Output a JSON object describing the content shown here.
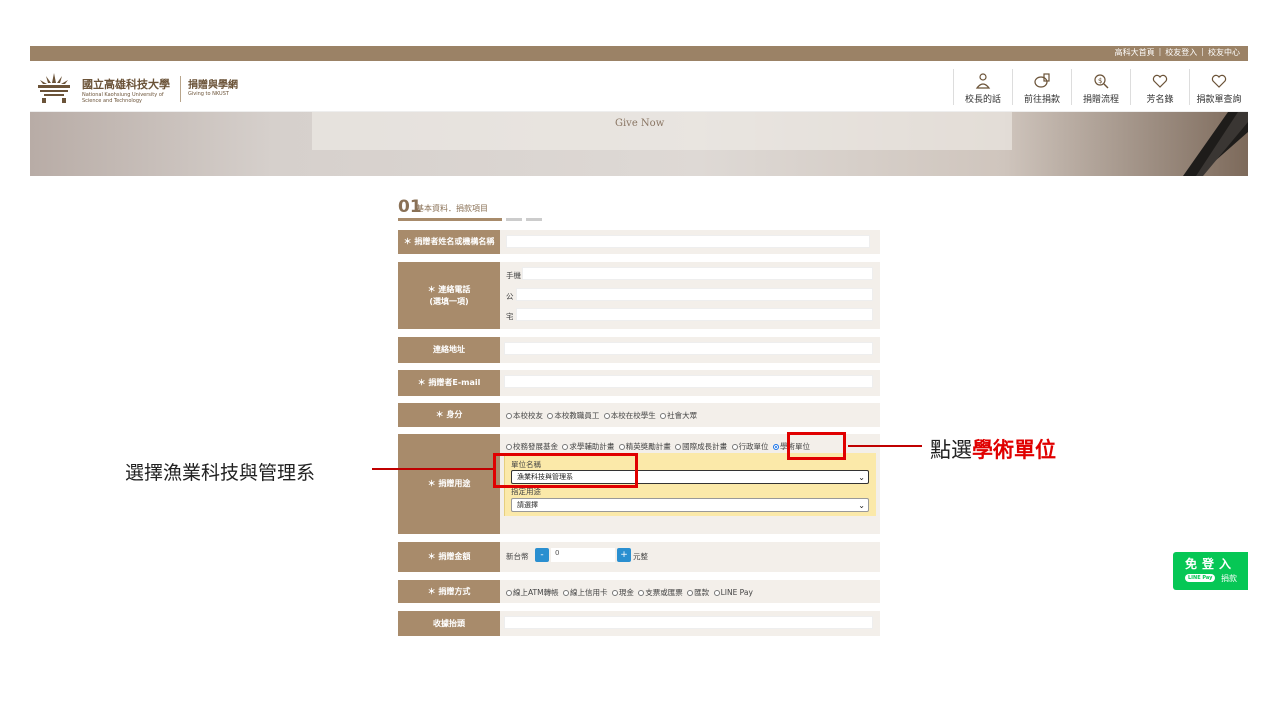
{
  "header": {
    "top_links": [
      "高科大首頁",
      "校友登入",
      "校友中心"
    ],
    "logo_cn": "國立高雄科技大學",
    "logo_en": "National Kaohsiung University of Science and Technology",
    "site_cn": "捐贈與學網",
    "site_en": "Giving to NKUST",
    "nav": [
      {
        "label": "校長的話",
        "icon": "person-icon"
      },
      {
        "label": "前往捐款",
        "icon": "coin-icon"
      },
      {
        "label": "捐贈流程",
        "icon": "search-money-icon"
      },
      {
        "label": "芳名錄",
        "icon": "heart-hands-icon"
      },
      {
        "label": "捐款單查詢",
        "icon": "heart-hands-icon"
      }
    ]
  },
  "banner": {
    "title": "Give Now"
  },
  "form": {
    "step_number": "01",
    "step_title": "基本資料．捐款項目",
    "labels": {
      "name": "＊ 捐贈者姓名或機構名稱",
      "phone": "＊ 連絡電話",
      "phone_note": "(選填一項)",
      "address": "連絡地址",
      "email": "＊ 捐贈者E-mail",
      "identity": "＊ 身分",
      "purpose": "＊ 捐贈用途",
      "amount": "＊ 捐贈金額",
      "method": "＊ 捐贈方式",
      "receipt": "收據抬頭"
    },
    "phone_fields": [
      "手機",
      "公",
      "宅"
    ],
    "identity_options": [
      "本校校友",
      "本校教職員工",
      "本校在校學生",
      "社會大眾"
    ],
    "purpose_options": [
      "校務發展基金",
      "求學輔助計畫",
      "精英獎勵計畫",
      "國際成長計畫",
      "行政單位",
      "學術單位"
    ],
    "purpose_selected": "學術單位",
    "unit_label": "單位名稱",
    "unit_value": "漁業科技與管理系",
    "use_label": "指定用途",
    "use_value": "請選擇",
    "amount_prefix": "新台幣",
    "amount_value": "0",
    "amount_suffix": "元整",
    "minus": "-",
    "plus": "+",
    "method_options": [
      "線上ATM轉帳",
      "線上信用卡",
      "現金",
      "支票或匯票",
      "匯款",
      "LINE Pay"
    ]
  },
  "annotations": {
    "left": "選擇漁業科技與管理系",
    "right_prefix": "點選",
    "right_highlight": "學術單位"
  },
  "line_widget": {
    "title": "免登入",
    "pay": "LINE Pay",
    "donate": "捐款"
  },
  "colors": {
    "brand": "#a88b6b",
    "topbar": "#9b8266",
    "annotation_red": "#e00000",
    "line_green": "#06c755"
  }
}
